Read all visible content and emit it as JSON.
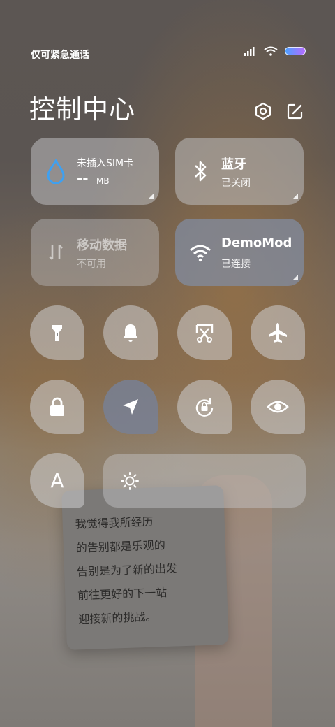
{
  "status_bar": {
    "carrier": "仅可紧急通话"
  },
  "header": {
    "title": "控制中心"
  },
  "tiles": {
    "data_usage": {
      "label": "未插入SIM卡",
      "value": "-- ",
      "unit": "MB"
    },
    "bluetooth": {
      "label": "蓝牙",
      "status": "已关闭"
    },
    "mobile_data": {
      "label": "移动数据",
      "status": "不可用"
    },
    "wifi": {
      "label": "DemoMod",
      "status": "已连接"
    }
  },
  "wallpaper_note": {
    "lines": [
      "我觉得我所经历",
      "的告别都是乐观的",
      "告别是为了新的出发",
      "前往更好的下一站",
      "迎接新的挑战。"
    ]
  },
  "font_button": {
    "label": "A"
  },
  "colors": {
    "accent_drop": "#3fa0f0",
    "active_tile": "#808ca0"
  }
}
